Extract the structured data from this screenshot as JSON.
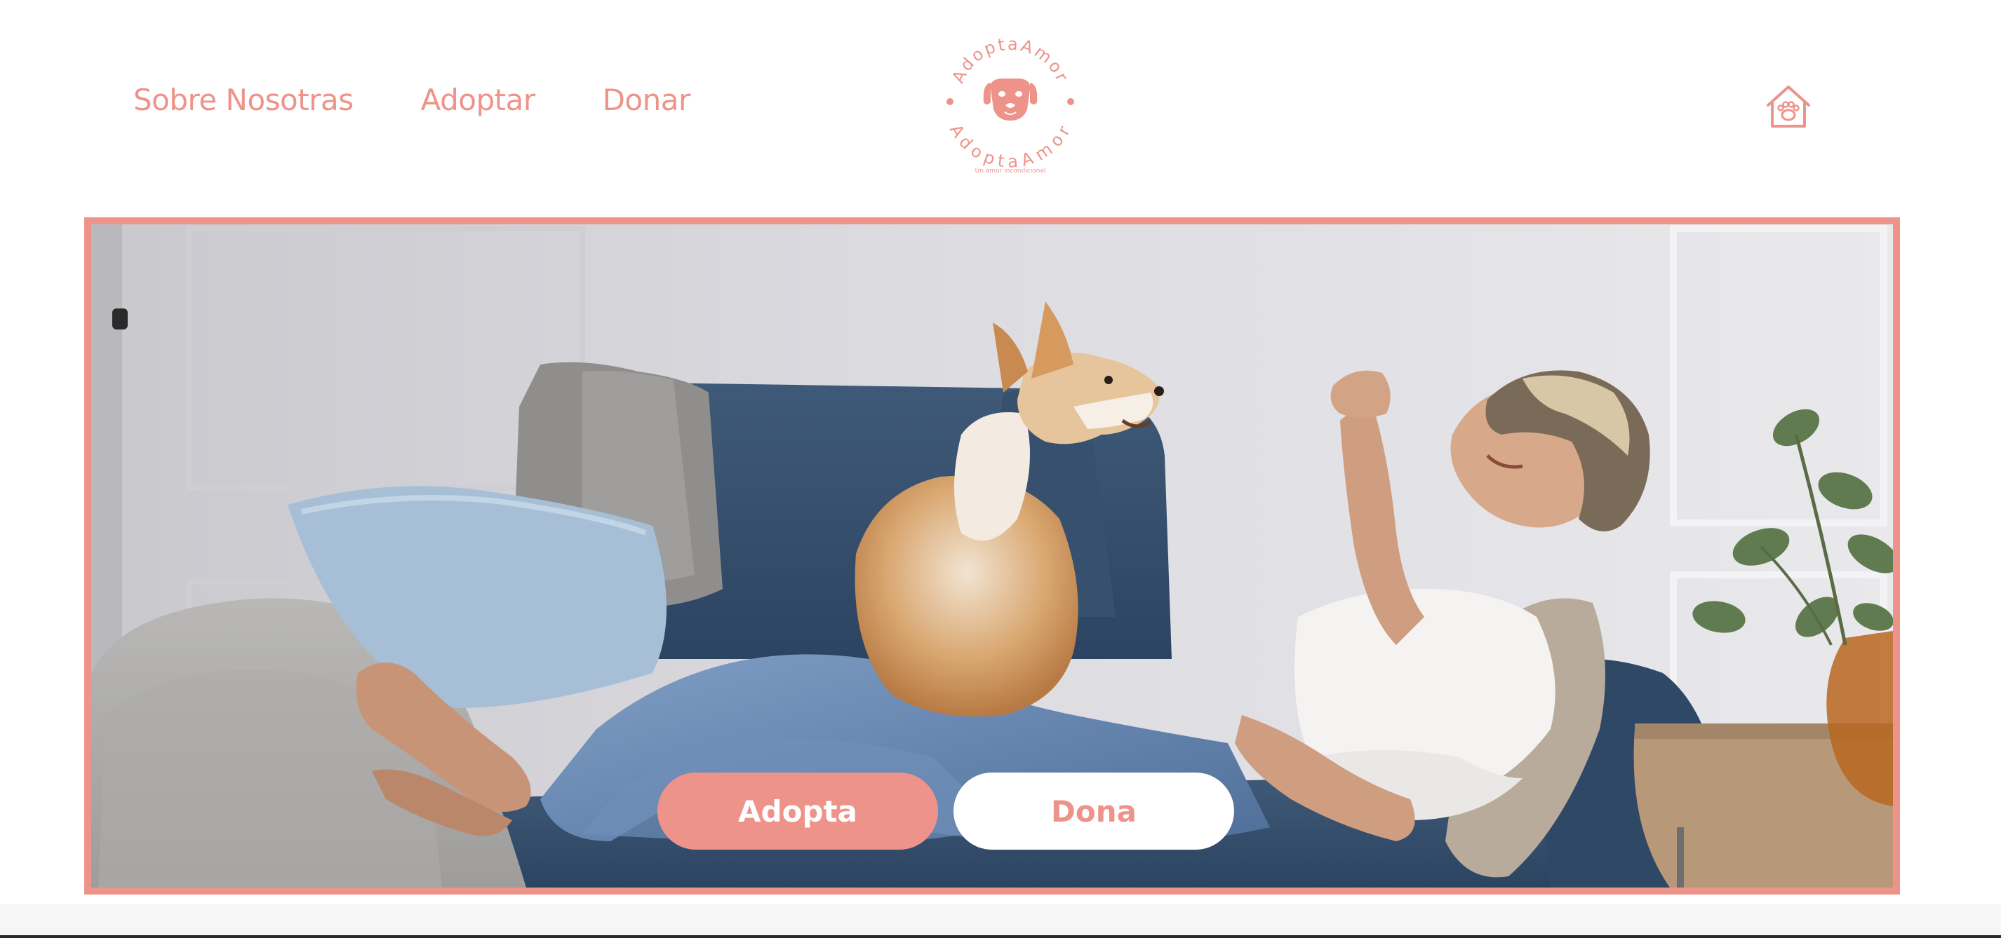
{
  "nav": {
    "items": [
      {
        "label": "Sobre Nosotras"
      },
      {
        "label": "Adoptar"
      },
      {
        "label": "Donar"
      }
    ]
  },
  "logo": {
    "brand_top": "AdoptaAmor",
    "brand_bottom": "AdoptaAmor",
    "tagline": "Un amor incondicional"
  },
  "hero": {
    "primary_label": "Adopta",
    "secondary_label": "Dona"
  },
  "icons": {
    "home": "home-paw-icon",
    "logo_mark": "dog-face-icon"
  },
  "colors": {
    "accent": "#ee938a",
    "background": "#ffffff"
  }
}
